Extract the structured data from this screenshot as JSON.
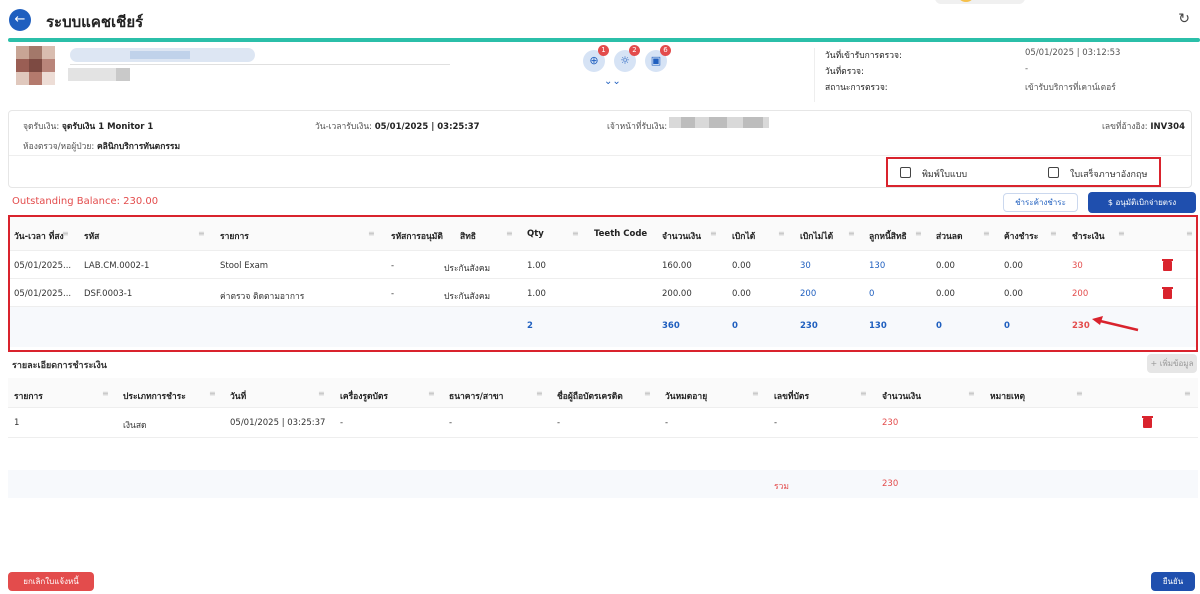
{
  "app": {
    "title": "ระบบแคชเชียร์"
  },
  "patient_info": {
    "labels": [
      "วันที่เข้ารับการตรวจ:",
      "วันที่ตรวจ:",
      "สถานะการตรวจ:"
    ],
    "values": [
      "05/01/2025 | 03:12:53",
      "-",
      "เข้ารับบริการที่เคาน์เตอร์"
    ],
    "badges": [
      "1",
      "2",
      "6"
    ]
  },
  "payment_info": {
    "point_label": "จุดรับเงิน:",
    "point_value": "จุดรับเงิน 1 Monitor 1",
    "datetime_label": "วัน-เวลารับเงิน:",
    "datetime_value": "05/01/2025 | 03:25:37",
    "staff_label": "เจ้าหน้าที่รับเงิน:",
    "ref_label": "เลขที่อ้างอิง:",
    "ref_value": "INV304",
    "room_label": "ห้องตรวจ/หอผู้ป่วย:",
    "room_value": "คลินิกบริการทันตกรรม"
  },
  "options": {
    "print_form": "พิมพ์ใบแบบ",
    "english_receipt": "ใบเสร็จภาษาอังกฤษ"
  },
  "balance": {
    "text": "Outstanding Balance: 230.00"
  },
  "actions": {
    "pay_outstanding": "ชำระค้างชำระ",
    "approve_discount": "อนุมัติเบิกจ่ายตรง",
    "add_data": "+ เพิ่มข้อมูล",
    "cancel_invoice": "ยกเลิกใบแจ้งหนี้",
    "confirm": "ยืนยัน"
  },
  "items_table": {
    "headers": [
      "วัน-เวลา ที่สง",
      "รหัส",
      "รายการ",
      "รหัสการอนุมัติ",
      "สิทธิ",
      "Qty",
      "Teeth Code",
      "จำนวนเงิน",
      "เบิกได้",
      "เบิกไม่ได้",
      "ลูกหนี้สิทธิ",
      "ส่วนลด",
      "ค้างชำระ",
      "ชำระเงิน"
    ],
    "rows": [
      [
        "05/01/2025...",
        "LAB.CM.0002-1",
        "Stool Exam",
        "-",
        "ประกันสังคม",
        "1.00",
        "",
        "160.00",
        "0.00",
        "30",
        "130",
        "0.00",
        "0.00",
        "30"
      ],
      [
        "05/01/2025...",
        "DSF.0003-1",
        "ค่าตรวจ ติดตามอาการ",
        "-",
        "ประกันสังคม",
        "1.00",
        "",
        "200.00",
        "0.00",
        "200",
        "0",
        "0.00",
        "0.00",
        "200"
      ]
    ],
    "totals": [
      "2",
      "360",
      "0",
      "230",
      "130",
      "0",
      "0",
      "230"
    ]
  },
  "payment_details": {
    "title": "รายละเอียดการชำระเงิน",
    "headers": [
      "รายการ",
      "ประเภทการชำระ",
      "วันที่",
      "เครื่องรูดบัตร",
      "ธนาคาร/สาขา",
      "ชื่อผู้ถือบัตรเครดิต",
      "วันหมดอายุ",
      "เลขที่บัตร",
      "จำนวนเงิน",
      "หมายเหตุ"
    ],
    "row": [
      "1",
      "เงินสด",
      "05/01/2025 | 03:25:37",
      "-",
      "-",
      "-",
      "-",
      "-",
      "230",
      ""
    ],
    "total_label": "รวม",
    "total_value": "230"
  }
}
